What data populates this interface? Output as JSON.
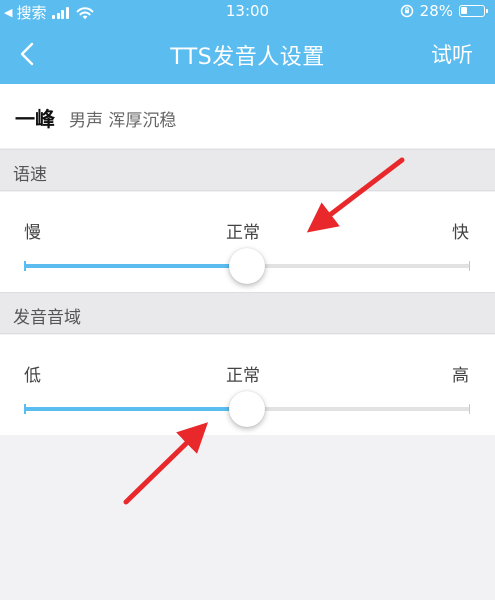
{
  "status_bar": {
    "carrier": "搜索",
    "time": "13:00",
    "battery_percent": "28%",
    "battery_level": 0.28
  },
  "nav": {
    "title": "TTS发音人设置",
    "action_label": "试听"
  },
  "voice": {
    "name": "一峰",
    "description": "男声 浑厚沉稳"
  },
  "speed": {
    "section_title": "语速",
    "min_label": "慢",
    "mid_label": "正常",
    "max_label": "快",
    "value": 0.5
  },
  "pitch": {
    "section_title": "发音音域",
    "min_label": "低",
    "mid_label": "正常",
    "max_label": "高",
    "value": 0.5
  },
  "colors": {
    "accent": "#5bbcf0",
    "annotation_arrow": "#e8282b"
  }
}
